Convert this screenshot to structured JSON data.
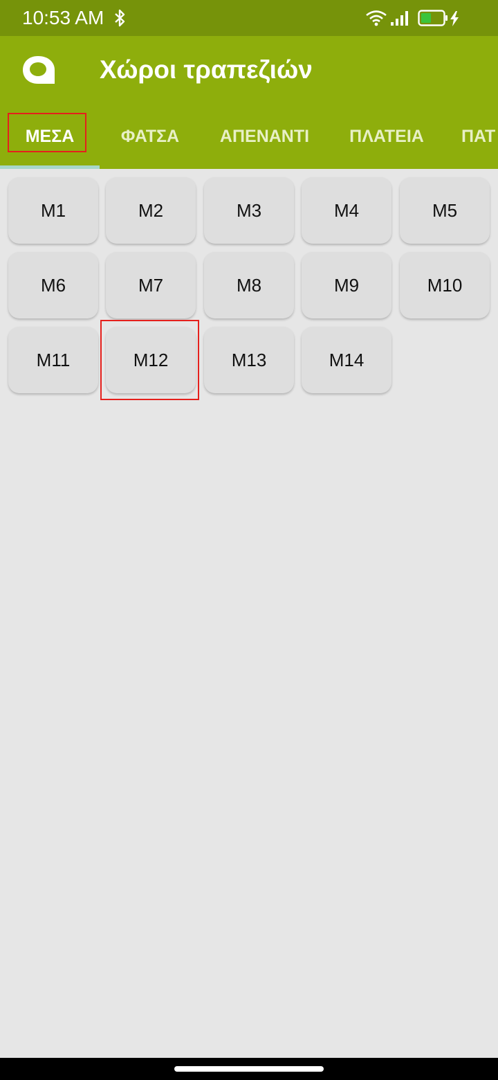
{
  "status_bar": {
    "time": "10:53 AM",
    "icons": [
      "bluetooth-icon",
      "wifi-icon",
      "signal-icon",
      "battery-icon",
      "charging-icon"
    ]
  },
  "app_bar": {
    "title": "Χώροι τραπεζιών",
    "logo_icon": "app-logo-icon"
  },
  "tabs": [
    {
      "label": "ΜΕΣΑ",
      "active": true
    },
    {
      "label": "ΦΑΤΣΑ",
      "active": false
    },
    {
      "label": "ΑΠΕΝΑΝΤΙ",
      "active": false
    },
    {
      "label": "ΠΛΑΤΕΙΑ",
      "active": false
    },
    {
      "label": "ΠΑΤ",
      "active": false
    }
  ],
  "tables": [
    "M1",
    "M2",
    "M3",
    "M4",
    "M5",
    "M6",
    "M7",
    "M8",
    "M9",
    "M10",
    "M11",
    "M12",
    "M13",
    "M14"
  ],
  "colors": {
    "status_bar": "#76930a",
    "app_bar": "#8eae0c",
    "tab_indicator": "#a7d7c9",
    "highlight": "#e5201c",
    "background": "#e6e6e6",
    "table_button": "#dedede"
  }
}
